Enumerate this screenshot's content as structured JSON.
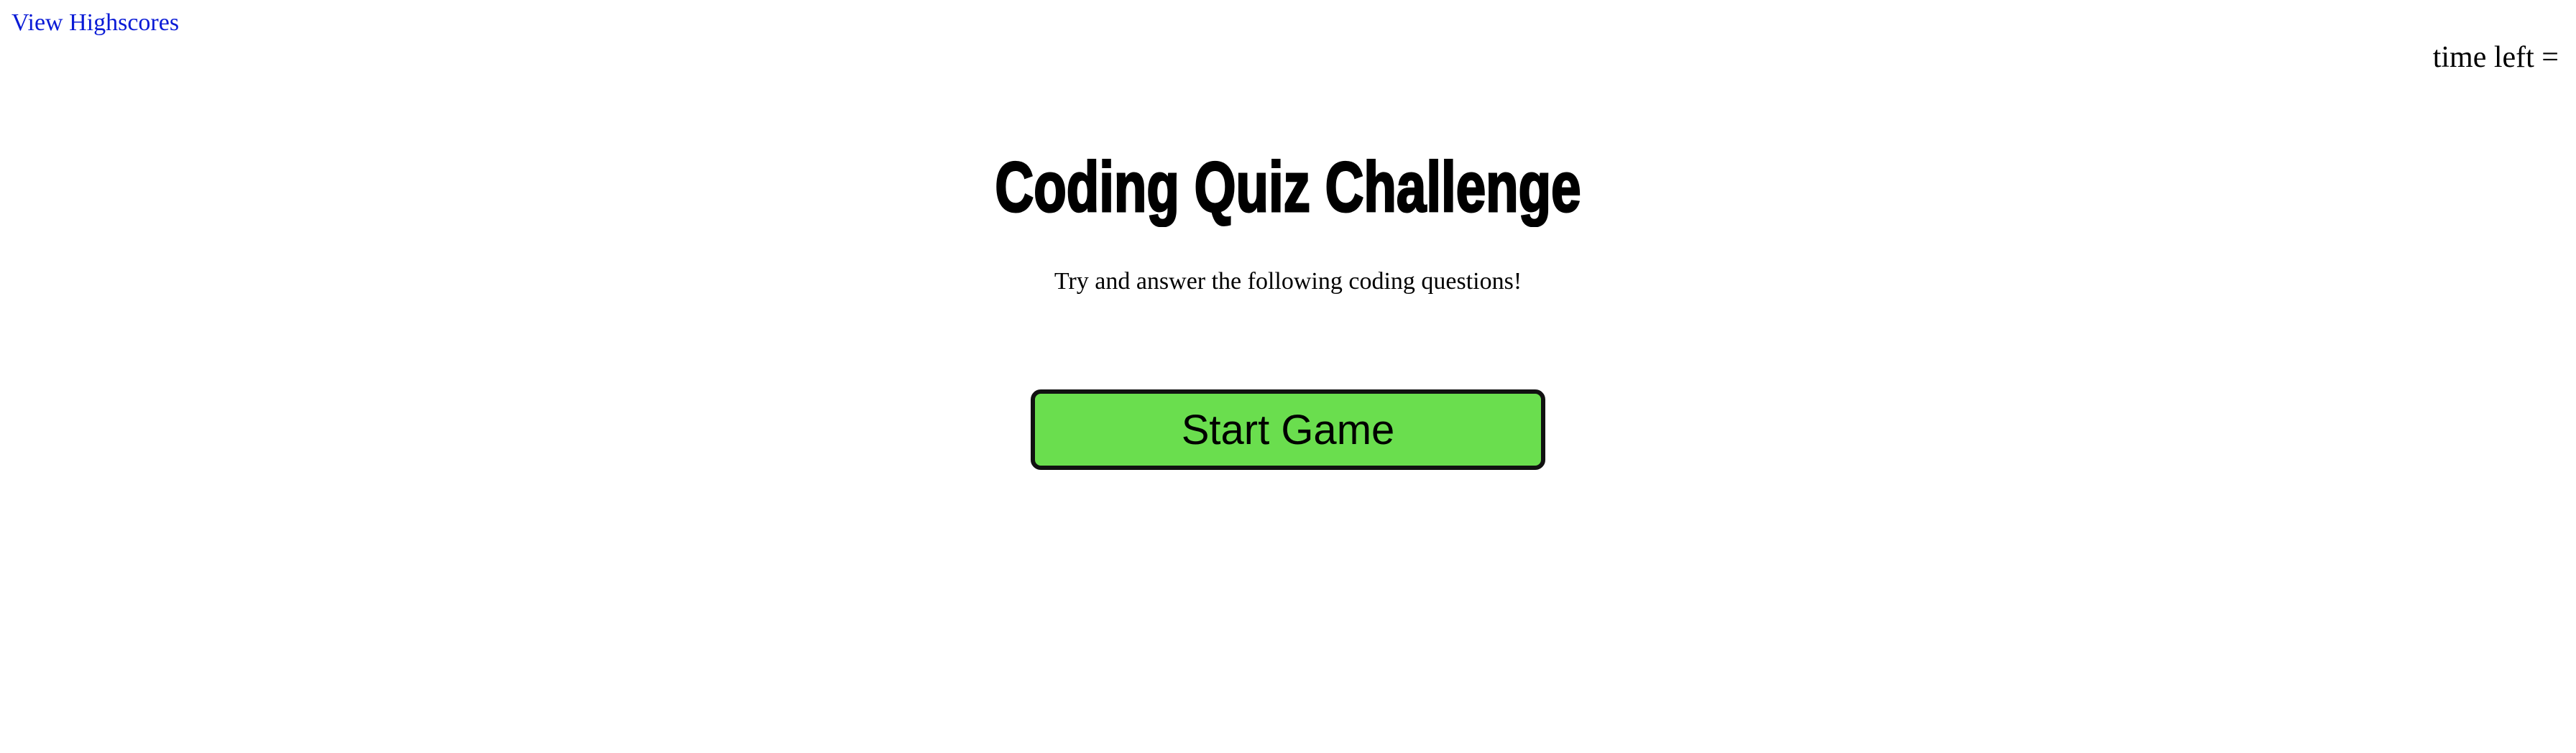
{
  "header": {
    "highscores_link": "View Highscores",
    "timer_label": "time left =",
    "timer_value": ""
  },
  "main": {
    "title": "Coding Quiz Challenge",
    "subtitle": "Try and answer the following coding questions!",
    "start_button_label": "Start Game"
  },
  "colors": {
    "link": "#0a1bd6",
    "start_button_bg": "#6ade4e",
    "start_button_border": "#111111",
    "background": "#ffffff"
  }
}
